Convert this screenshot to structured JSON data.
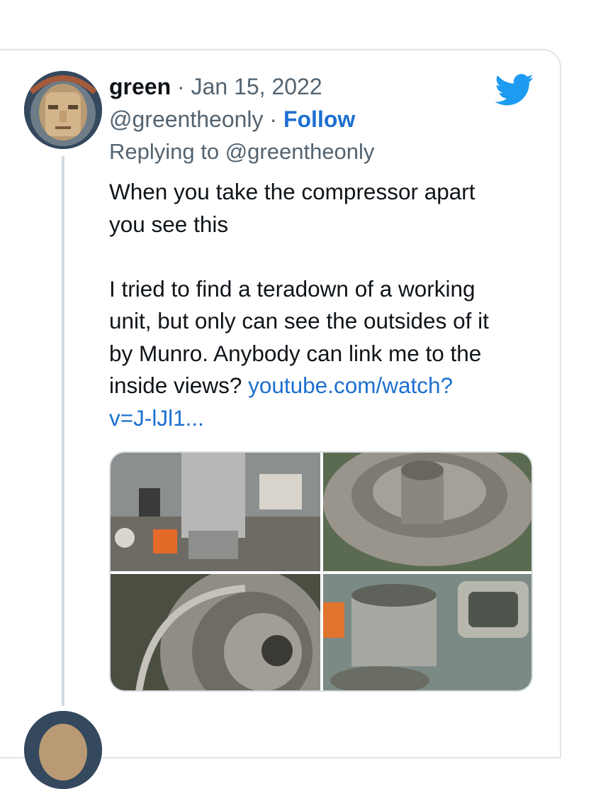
{
  "tweet": {
    "author_name": "green",
    "separator": "·",
    "date": "Jan 15, 2022",
    "handle": "@greentheonly",
    "follow_label": "Follow",
    "replying_to": "Replying to @greentheonly",
    "text_lines": [
      "When you take the compressor apart",
      "you see this",
      "I tried to find a teradown of a working",
      "unit, but only can see the outsides of it",
      "by Munro. Anybody can link me to the",
      "inside views? "
    ],
    "link_line1": "youtube.com/watch?",
    "link_line2": "v=J-lJl1..."
  },
  "icons": {
    "brand": "twitter-bird-icon",
    "brand_color": "#1d9bf0"
  },
  "colors": {
    "link": "#1d6fd0",
    "muted": "#536471",
    "thread_line": "#cfd9de"
  }
}
